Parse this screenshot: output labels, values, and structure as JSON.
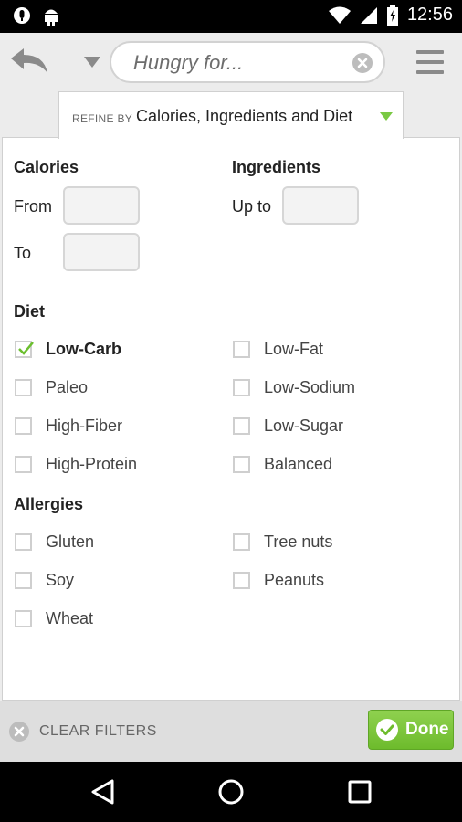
{
  "status_bar": {
    "time": "12:56",
    "left_icons": [
      "microphone-icon",
      "android-debug-icon"
    ],
    "right_icons": [
      "wifi-icon",
      "cellular-signal-icon",
      "battery-charging-icon"
    ]
  },
  "toolbar": {
    "search_placeholder": "Hungry for...",
    "icons": [
      "back-arrow-icon",
      "dropdown-arrow-icon",
      "clear-search-icon",
      "hamburger-menu-icon"
    ]
  },
  "refine": {
    "label": "REFINE BY",
    "value": "Calories, Ingredients and Diet",
    "arrow_color": "#7ac943"
  },
  "calories": {
    "title": "Calories",
    "from_label": "From",
    "to_label": "To",
    "from_value": "",
    "to_value": ""
  },
  "ingredients": {
    "title": "Ingredients",
    "up_to_label": "Up to",
    "up_to_value": ""
  },
  "diet": {
    "title": "Diet",
    "options": [
      {
        "label": "Low-Carb",
        "checked": true
      },
      {
        "label": "Low-Fat",
        "checked": false
      },
      {
        "label": "Paleo",
        "checked": false
      },
      {
        "label": "Low-Sodium",
        "checked": false
      },
      {
        "label": "High-Fiber",
        "checked": false
      },
      {
        "label": "Low-Sugar",
        "checked": false
      },
      {
        "label": "High-Protein",
        "checked": false
      },
      {
        "label": "Balanced",
        "checked": false
      }
    ]
  },
  "allergies": {
    "title": "Allergies",
    "options": [
      {
        "label": "Gluten",
        "checked": false
      },
      {
        "label": "Tree nuts",
        "checked": false
      },
      {
        "label": "Soy",
        "checked": false
      },
      {
        "label": "Peanuts",
        "checked": false
      },
      {
        "label": "Wheat",
        "checked": false
      }
    ]
  },
  "footer": {
    "clear_label": "CLEAR FILTERS",
    "done_label": "Done",
    "done_color": "#7cc63a"
  },
  "nav_bar": {
    "icons": [
      "back-triangle-icon",
      "home-circle-icon",
      "recents-square-icon"
    ]
  }
}
